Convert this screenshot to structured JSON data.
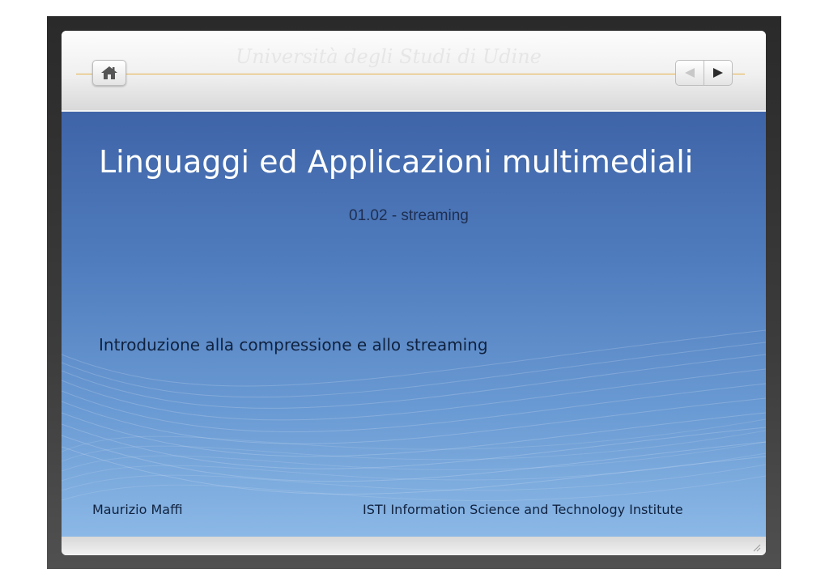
{
  "header": {
    "watermark": "Università degli Studi di Udine",
    "home_icon": "home-icon",
    "prev_icon": "arrow-left-icon",
    "next_icon": "arrow-right-icon",
    "rule_color": "#e3b24a"
  },
  "slide": {
    "title": "Linguaggi ed Applicazioni multimediali",
    "subtitle": "01.02 - streaming",
    "intro": "Introduzione alla compressione e allo streaming",
    "author": "Maurizio Maffi",
    "institute": "ISTI   Information Science and Technology Institute",
    "background_color": "#4f7cbd"
  }
}
